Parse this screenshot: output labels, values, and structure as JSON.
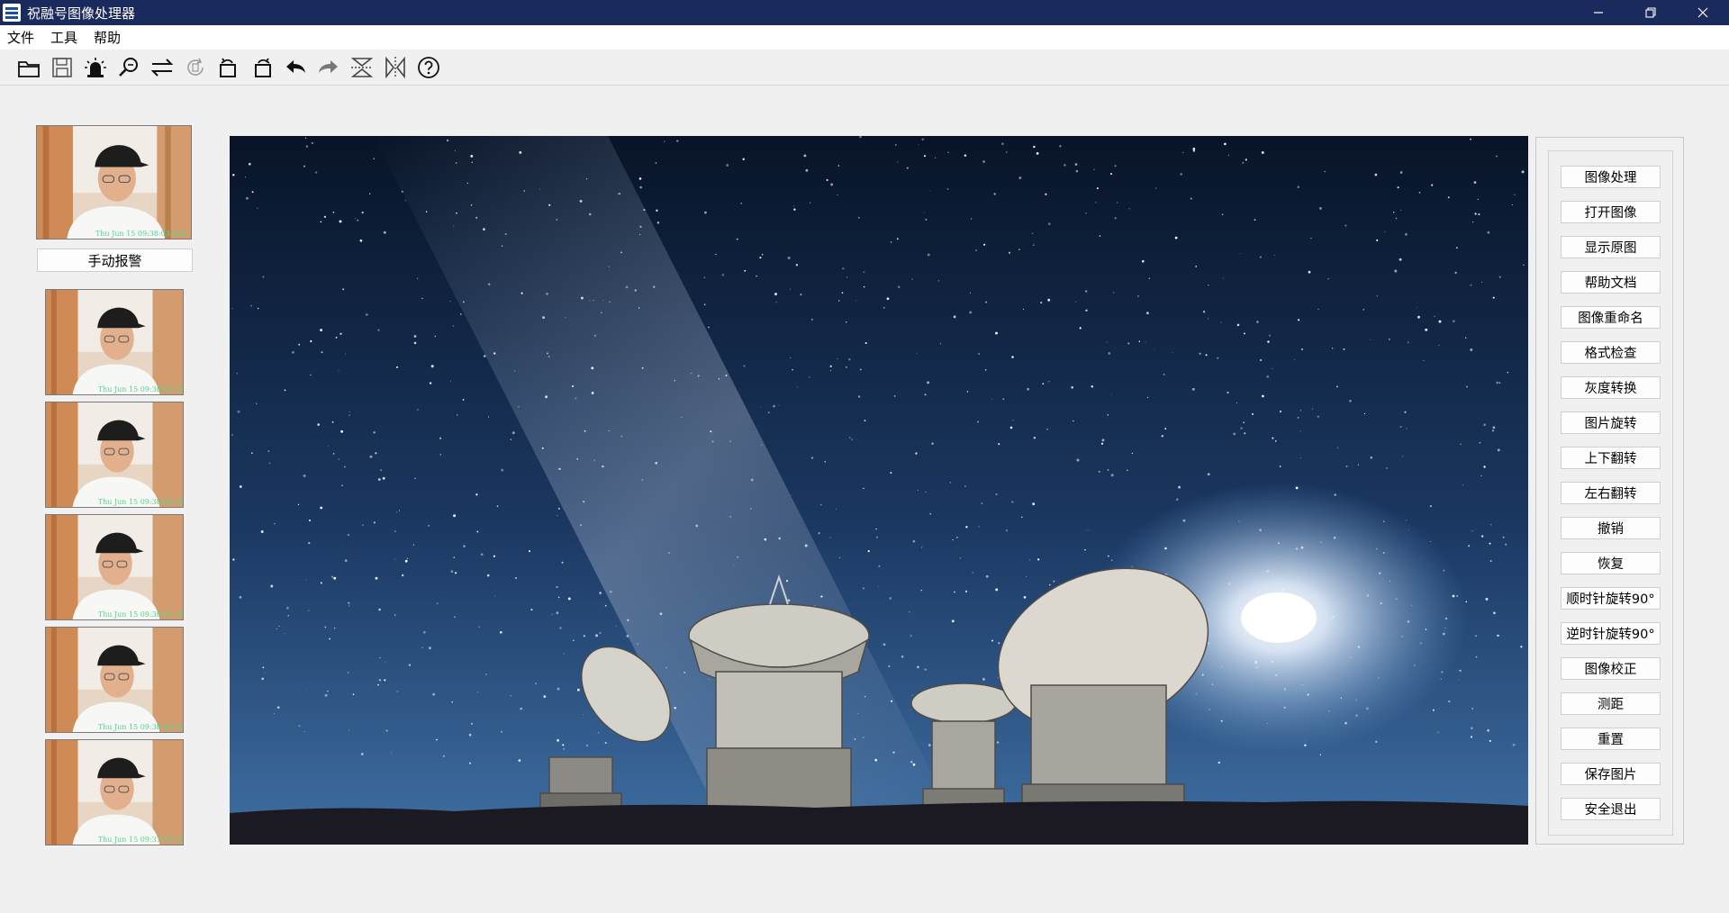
{
  "window": {
    "title": "祝融号图像处理器",
    "controls": [
      "minimize-icon",
      "restore-icon",
      "close-icon"
    ]
  },
  "menu": [
    "文件",
    "工具",
    "帮助"
  ],
  "toolbar": {
    "icons": [
      "open-folder-icon",
      "save-icon",
      "alarm-icon",
      "zoom-icon",
      "swap-icon",
      "rotate-disabled-icon",
      "rotate-left-icon",
      "rotate-right-icon",
      "undo-icon",
      "redo-icon",
      "flip-vertical-icon",
      "flip-horizontal-icon",
      "help-icon"
    ]
  },
  "left": {
    "main_stamp": "Thu Jun 15 09:38:03 202",
    "alarm_button": "手动报警",
    "thumbnails": [
      {
        "stamp": "Thu Jun 15 09:38:03 202"
      },
      {
        "stamp": "Thu Jun 15 09:38:02 202"
      },
      {
        "stamp": "Thu Jun 15 09:38:01 202"
      },
      {
        "stamp": "Thu Jun 15 09:38:00 202"
      },
      {
        "stamp": "Thu Jun 15 09:37:59 202"
      }
    ]
  },
  "panel": {
    "buttons": [
      "图像处理",
      "打开图像",
      "显示原图",
      "帮助文档",
      "图像重命名",
      "格式检查",
      "灰度转换",
      "图片旋转",
      "上下翻转",
      "左右翻转",
      "撤销",
      "恢复",
      "顺时针旋转90°",
      "逆时针旋转90°",
      "图像校正",
      "测距",
      "重置",
      "保存图片",
      "安全退出"
    ]
  },
  "colors": {
    "titlebar": "#1b2a5c",
    "background": "#f0f0f0",
    "timestamp": "#54d68f",
    "sky_top": "#081428",
    "sky_bottom": "#3f6fa3"
  }
}
